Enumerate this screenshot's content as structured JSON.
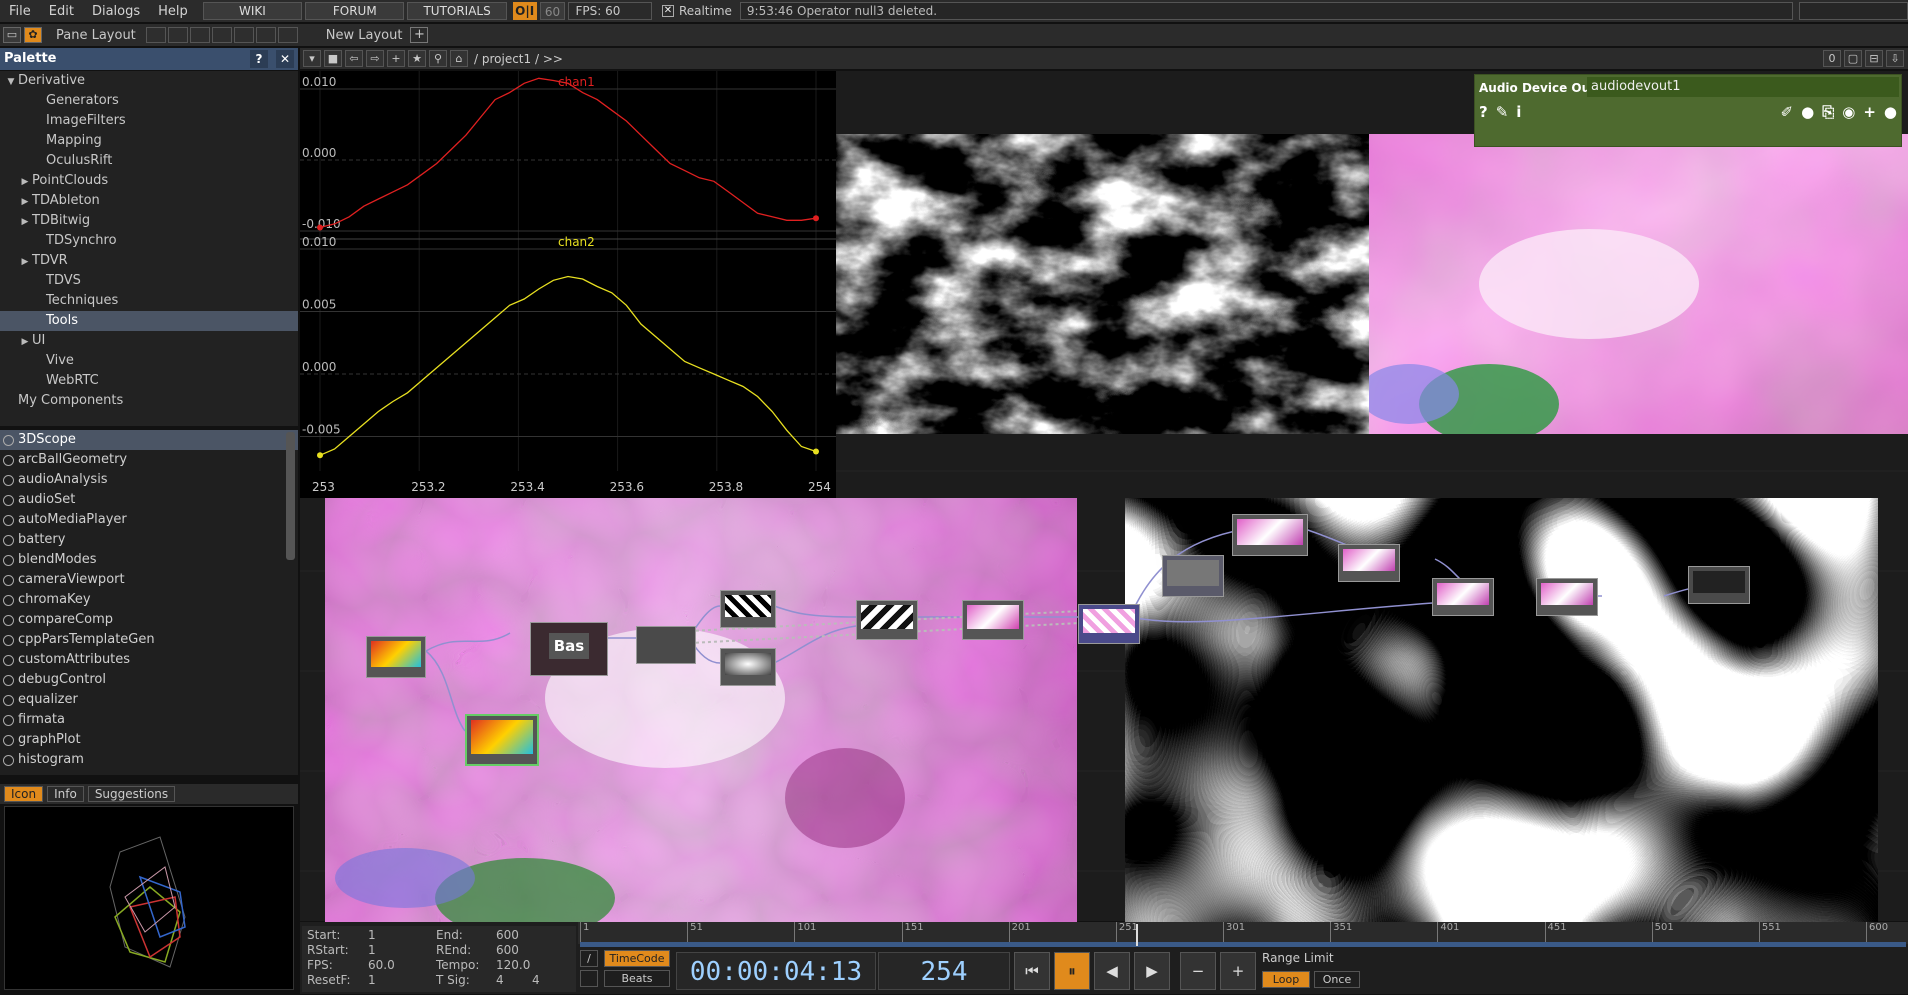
{
  "menu": {
    "items": [
      "File",
      "Edit",
      "Dialogs",
      "Help"
    ],
    "links": [
      "WIKI",
      "FORUM",
      "TUTORIALS"
    ],
    "oi": "O|I",
    "fps_cap": "60",
    "fps": "FPS:  60",
    "realtime": "Realtime",
    "status": "9:53:46 Operator null3 deleted."
  },
  "toolbar2": {
    "pane_layout": "Pane Layout",
    "new_layout": "New Layout"
  },
  "palette": {
    "title": "Palette",
    "help": "?",
    "close": "✕",
    "tree": [
      {
        "label": "Derivative",
        "expand": "▼",
        "indent": 0
      },
      {
        "label": "Generators",
        "expand": "",
        "indent": 2
      },
      {
        "label": "ImageFilters",
        "expand": "",
        "indent": 2
      },
      {
        "label": "Mapping",
        "expand": "",
        "indent": 2
      },
      {
        "label": "OculusRift",
        "expand": "",
        "indent": 2
      },
      {
        "label": "PointClouds",
        "expand": "▶",
        "indent": 1
      },
      {
        "label": "TDAbleton",
        "expand": "▶",
        "indent": 1
      },
      {
        "label": "TDBitwig",
        "expand": "▶",
        "indent": 1
      },
      {
        "label": "TDSynchro",
        "expand": "",
        "indent": 2
      },
      {
        "label": "TDVR",
        "expand": "▶",
        "indent": 1
      },
      {
        "label": "TDVS",
        "expand": "",
        "indent": 2
      },
      {
        "label": "Techniques",
        "expand": "",
        "indent": 2
      },
      {
        "label": "Tools",
        "expand": "",
        "indent": 2,
        "sel": true
      },
      {
        "label": "UI",
        "expand": "▶",
        "indent": 1
      },
      {
        "label": "Vive",
        "expand": "",
        "indent": 2
      },
      {
        "label": "WebRTC",
        "expand": "",
        "indent": 2
      },
      {
        "label": "My Components",
        "expand": "",
        "indent": 0
      }
    ],
    "components": [
      "3DScope",
      "arcBallGeometry",
      "audioAnalysis",
      "audioSet",
      "autoMediaPlayer",
      "battery",
      "blendModes",
      "cameraViewport",
      "chromaKey",
      "compareComp",
      "cppParsTemplateGen",
      "customAttributes",
      "debugControl",
      "equalizer",
      "firmata",
      "graphPlot",
      "histogram"
    ],
    "tabs": [
      "Icon",
      "Info",
      "Suggestions"
    ]
  },
  "network": {
    "path": "/ project1 / >>",
    "counter": "0"
  },
  "audio_panel": {
    "title": "Audio Device Out",
    "name": "audiodevout1",
    "help": "?",
    "info": "i"
  },
  "chart_data": {
    "type": "line",
    "x_ticks": [
      "253",
      "253.2",
      "253.4",
      "253.6",
      "253.8",
      "254"
    ],
    "series": [
      {
        "name": "chan1",
        "color": "#e02020",
        "ylim": [
          -0.01,
          0.01
        ],
        "yticks": [
          "0.010",
          "0.000",
          "-0.010"
        ],
        "values": [
          -0.0095,
          -0.009,
          -0.008,
          -0.0065,
          -0.0055,
          -0.0045,
          -0.0035,
          -0.002,
          -0.0005,
          0.0015,
          0.0035,
          0.006,
          0.0085,
          0.0095,
          0.0108,
          0.0115,
          0.0112,
          0.0108,
          0.0095,
          0.0085,
          0.007,
          0.0055,
          0.0035,
          0.0015,
          -0.0005,
          -0.0015,
          -0.0025,
          -0.003,
          -0.0045,
          -0.006,
          -0.0075,
          -0.008,
          -0.0085,
          -0.0085,
          -0.0082
        ]
      },
      {
        "name": "chan2",
        "color": "#e8e020",
        "ylim": [
          -0.006,
          0.01
        ],
        "yticks": [
          "0.010",
          "0.005",
          "0.000",
          "-0.005"
        ],
        "values": [
          -0.0065,
          -0.006,
          -0.005,
          -0.004,
          -0.003,
          -0.0022,
          -0.0015,
          -0.0005,
          0.0005,
          0.0015,
          0.0025,
          0.0035,
          0.0045,
          0.0055,
          0.006,
          0.0068,
          0.0075,
          0.0078,
          0.0076,
          0.007,
          0.0065,
          0.0055,
          0.004,
          0.003,
          0.002,
          0.001,
          0.0005,
          0.0,
          -0.0005,
          -0.001,
          -0.0018,
          -0.003,
          -0.0045,
          -0.0058,
          -0.0062
        ]
      }
    ]
  },
  "nodes": {
    "bas": "Bas"
  },
  "control": {
    "start_label": "Start:",
    "start": "1",
    "end_label": "End:",
    "end": "600",
    "rstart_label": "RStart:",
    "rstart": "1",
    "rend_label": "REnd:",
    "rend": "600",
    "fps_label": "FPS:",
    "fps": "60.0",
    "tempo_label": "Tempo:",
    "tempo": "120.0",
    "resetf_label": "ResetF:",
    "resetf": "1",
    "tsig_label": "T Sig:",
    "tsig1": "4",
    "tsig2": "4",
    "timecode_btn": "TimeCode",
    "beats_btn": "Beats",
    "timecode": "00:00:04:13",
    "frame": "254",
    "range_limit": "Range Limit",
    "loop": "Loop",
    "once": "Once",
    "ruler": [
      "1",
      "51",
      "101",
      "151",
      "201",
      "251",
      "301",
      "351",
      "401",
      "451",
      "501",
      "551",
      "600"
    ]
  }
}
